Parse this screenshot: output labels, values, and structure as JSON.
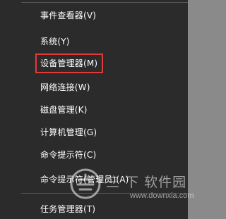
{
  "menu": {
    "items": [
      {
        "label": "事件查看器(V)"
      },
      {
        "label": "系统(Y)"
      },
      {
        "label": "设备管理器(M)"
      },
      {
        "label": "网络连接(W)"
      },
      {
        "label": "磁盘管理(K)"
      },
      {
        "label": "计算机管理(G)"
      },
      {
        "label": "命令提示符(C)"
      },
      {
        "label": "命令提示符(管理员)(A)"
      },
      {
        "label": "任务管理器(T)"
      }
    ],
    "highlighted_item": "设备管理器(M)",
    "highlight_color": "#e23a3a",
    "background_color": "#2b2b2b",
    "text_color": "#ffffff"
  },
  "watermark": {
    "title": "三 下 软件园",
    "url": "www.downxia.com"
  }
}
